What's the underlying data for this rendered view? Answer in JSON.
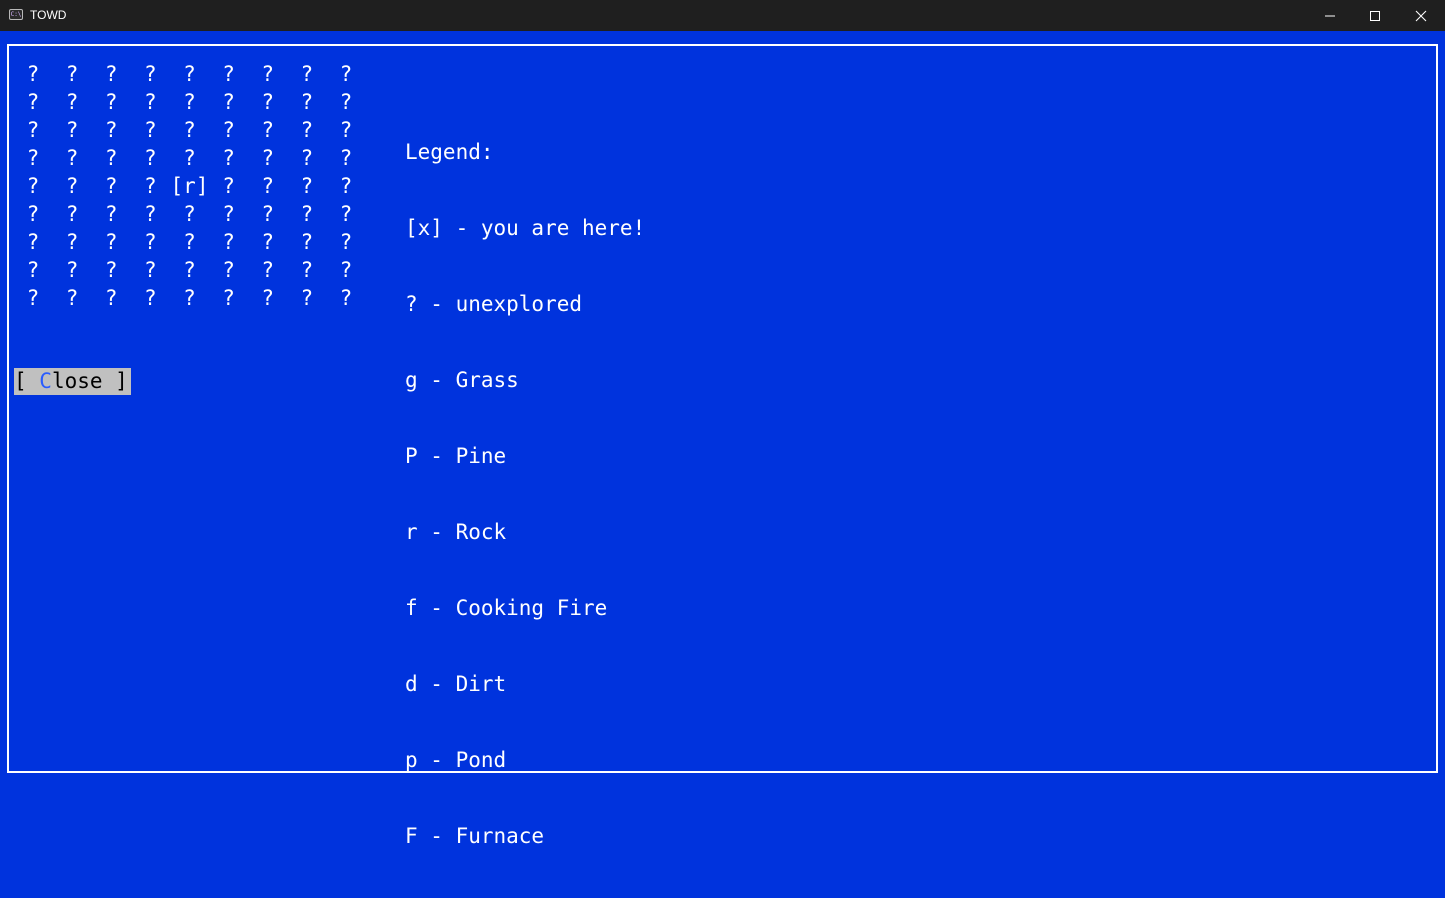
{
  "window": {
    "title": "TOWD",
    "icon": "terminal-icon",
    "icon_text": "C:\\",
    "controls": [
      "minimize-icon",
      "maximize-icon",
      "close-icon"
    ]
  },
  "colors": {
    "background": "#0033dd",
    "text": "#ffffff",
    "button_bg": "#c0c0c0",
    "hotkey": "#2a5cff"
  },
  "map": {
    "rows": [
      [
        "?",
        "?",
        "?",
        "?",
        "?",
        "?",
        "?",
        "?",
        "?"
      ],
      [
        "?",
        "?",
        "?",
        "?",
        "?",
        "?",
        "?",
        "?",
        "?"
      ],
      [
        "?",
        "?",
        "?",
        "?",
        "?",
        "?",
        "?",
        "?",
        "?"
      ],
      [
        "?",
        "?",
        "?",
        "?",
        "?",
        "?",
        "?",
        "?",
        "?"
      ],
      [
        "?",
        "?",
        "?",
        "?",
        "[r]",
        "?",
        "?",
        "?",
        "?"
      ],
      [
        "?",
        "?",
        "?",
        "?",
        "?",
        "?",
        "?",
        "?",
        "?"
      ],
      [
        "?",
        "?",
        "?",
        "?",
        "?",
        "?",
        "?",
        "?",
        "?"
      ],
      [
        "?",
        "?",
        "?",
        "?",
        "?",
        "?",
        "?",
        "?",
        "?"
      ],
      [
        "?",
        "?",
        "?",
        "?",
        "?",
        "?",
        "?",
        "?",
        "?"
      ]
    ]
  },
  "legend": {
    "heading": "Legend:",
    "entries": [
      "[x] - you are here!",
      "? - unexplored",
      "g - Grass",
      "P - Pine",
      "r - Rock",
      "f - Cooking Fire",
      "d - Dirt",
      "p - Pond",
      "F - Furnace"
    ]
  },
  "close_button": {
    "prefix": "[ ",
    "hotkey": "C",
    "rest": "lose ]"
  }
}
